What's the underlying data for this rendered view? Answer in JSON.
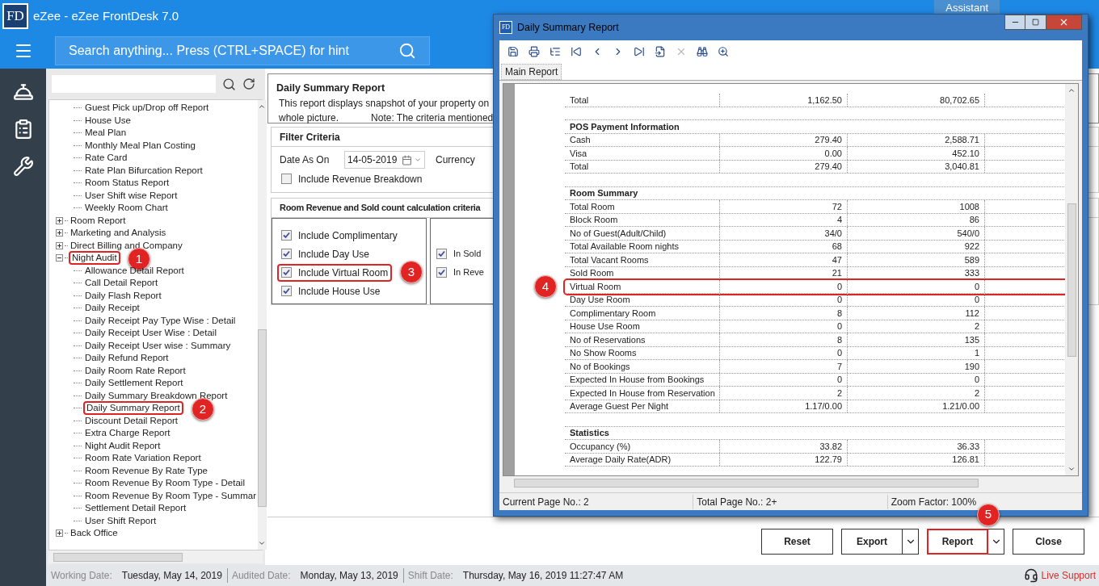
{
  "app": {
    "logo": "FD",
    "title": "eZee - eZee FrontDesk 7.0",
    "search_placeholder": "Search anything... Press (CTRL+SPACE) for hint",
    "assistant": "Assistant"
  },
  "tree": {
    "continued_items": [
      "Guest Pick up/Drop off Report",
      "House Use",
      "Meal Plan",
      "Monthly Meal Plan Costing",
      "Rate Card",
      "Rate Plan Bifurcation Report",
      "Room Status Report",
      "User Shift wise Report",
      "Weekly Room Chart"
    ],
    "items": [
      {
        "label": "Room Report",
        "expanded": false
      },
      {
        "label": "Marketing and Analysis",
        "expanded": false
      },
      {
        "label": "Direct Billing and Company",
        "expanded": false
      },
      {
        "label": "Night Audit",
        "expanded": true,
        "callout": "1",
        "children": [
          {
            "label": "Allowance Detail Report"
          },
          {
            "label": "Call Detail Report"
          },
          {
            "label": "Daily Flash Report"
          },
          {
            "label": "Daily Receipt"
          },
          {
            "label": "Daily Receipt Pay Type Wise : Detail"
          },
          {
            "label": "Daily Receipt User Wise : Detail"
          },
          {
            "label": "Daily Receipt User wise : Summary"
          },
          {
            "label": "Daily Refund Report"
          },
          {
            "label": "Daily Room Rate Report"
          },
          {
            "label": "Daily Settlement Report"
          },
          {
            "label": "Daily Summary Breakdown Report"
          },
          {
            "label": "Daily Summary Report",
            "callout": "2"
          },
          {
            "label": "Discount Detail Report"
          },
          {
            "label": "Extra Charge Report"
          },
          {
            "label": "Night Audit Report"
          },
          {
            "label": "Room Rate Variation Report"
          },
          {
            "label": "Room Revenue By Rate Type"
          },
          {
            "label": "Room Revenue By Room Type - Detail"
          },
          {
            "label": "Room Revenue By Room Type - Summar"
          },
          {
            "label": "Settlement Detail Report"
          },
          {
            "label": "User Shift Report"
          }
        ]
      },
      {
        "label": "Back Office",
        "expanded": false
      }
    ]
  },
  "report_info": {
    "title": "Daily Summary Report",
    "line_1": "This report displays snapshot of your property on",
    "line_2": "whole picture.",
    "note": "Note: The criteria mentioned"
  },
  "filter": {
    "title": "Filter Criteria",
    "date_label": "Date As On",
    "date_value": "14-05-2019",
    "currency_label": "Currency",
    "option": {
      "label": "Include Revenue Breakdown",
      "checked": false
    }
  },
  "criteria": {
    "title": "Room Revenue and Sold count calculation criteria",
    "left": [
      {
        "label": "Include Complimentary",
        "checked": true
      },
      {
        "label": "Include Day Use",
        "checked": true
      },
      {
        "label": "Include Virtual Room",
        "checked": true,
        "callout": "3"
      },
      {
        "label": "Include House Use",
        "checked": true
      }
    ],
    "right": [
      {
        "label": "In Sold",
        "checked": true
      },
      {
        "label": "In Reve",
        "checked": true
      }
    ]
  },
  "buttons": [
    {
      "label": "Reset",
      "dropdown": false
    },
    {
      "label": "Export",
      "dropdown": true
    },
    {
      "label": "Report",
      "dropdown": true,
      "callout": "5"
    },
    {
      "label": "Close",
      "dropdown": false
    }
  ],
  "status_bar": {
    "items": [
      {
        "label": "Working Date:",
        "value": "Tuesday, May 14, 2019"
      },
      {
        "label": "Audited Date:",
        "value": "Monday, May 13, 2019"
      },
      {
        "label": "Shift Date:",
        "value": "Thursday, May 16, 2019 11:27:47 AM"
      }
    ],
    "live_support": "Live Support"
  },
  "report_window": {
    "icon": "FD",
    "title": "Daily Summary Report",
    "tab": {
      "label": "Main Report",
      "selected": true
    },
    "sections": [
      {
        "rows": [
          {
            "cells": [
              "Total",
              "1,162.50",
              "80,702.65"
            ]
          }
        ]
      },
      {
        "title": "POS Payment Information",
        "rows": [
          {
            "cells": [
              "Cash",
              "279.40",
              "2,588.71"
            ]
          },
          {
            "cells": [
              "Visa",
              "0.00",
              "452.10"
            ]
          },
          {
            "cells": [
              "Total",
              "279.40",
              "3,040.81"
            ]
          }
        ]
      },
      {
        "title": "Room Summary",
        "rows": [
          {
            "cells": [
              "Total Room",
              "72",
              "1008"
            ]
          },
          {
            "cells": [
              "Block Room",
              "4",
              "86"
            ]
          },
          {
            "cells": [
              "No of Guest(Adult/Child)",
              "34/0",
              "540/0"
            ]
          },
          {
            "cells": [
              "Total Available Room nights",
              "68",
              "922"
            ]
          },
          {
            "cells": [
              "Total Vacant Rooms",
              "47",
              "589"
            ]
          },
          {
            "cells": [
              "Sold Room",
              "21",
              "333"
            ]
          },
          {
            "cells": [
              "Virtual Room",
              "0",
              "0"
            ],
            "callout": "4"
          },
          {
            "cells": [
              "Day Use Room",
              "0",
              "0"
            ]
          },
          {
            "cells": [
              "Complimentary Room",
              "8",
              "112"
            ]
          },
          {
            "cells": [
              "House Use Room",
              "0",
              "2"
            ]
          },
          {
            "cells": [
              "No of Reservations",
              "8",
              "135"
            ]
          },
          {
            "cells": [
              "No Show Rooms",
              "0",
              "1"
            ]
          },
          {
            "cells": [
              "No of Bookings",
              "7",
              "190"
            ]
          },
          {
            "cells": [
              "Expected In House from Bookings",
              "0",
              "0"
            ]
          },
          {
            "cells": [
              "Expected In House from Reservation",
              "2",
              "2"
            ]
          },
          {
            "cells": [
              "Average Guest Per Night",
              "1.17/0.00",
              "1.21/0.00"
            ]
          }
        ]
      },
      {
        "title": "Statistics",
        "rows": [
          {
            "cells": [
              "Occupancy (%)",
              "33.82",
              "36.33"
            ]
          },
          {
            "cells": [
              "Average Daily Rate(ADR)",
              "122.79",
              "126.81"
            ]
          }
        ]
      }
    ],
    "status": [
      "Current Page No.: 2",
      "Total Page No.: 2+",
      "Zoom Factor: 100%"
    ]
  }
}
